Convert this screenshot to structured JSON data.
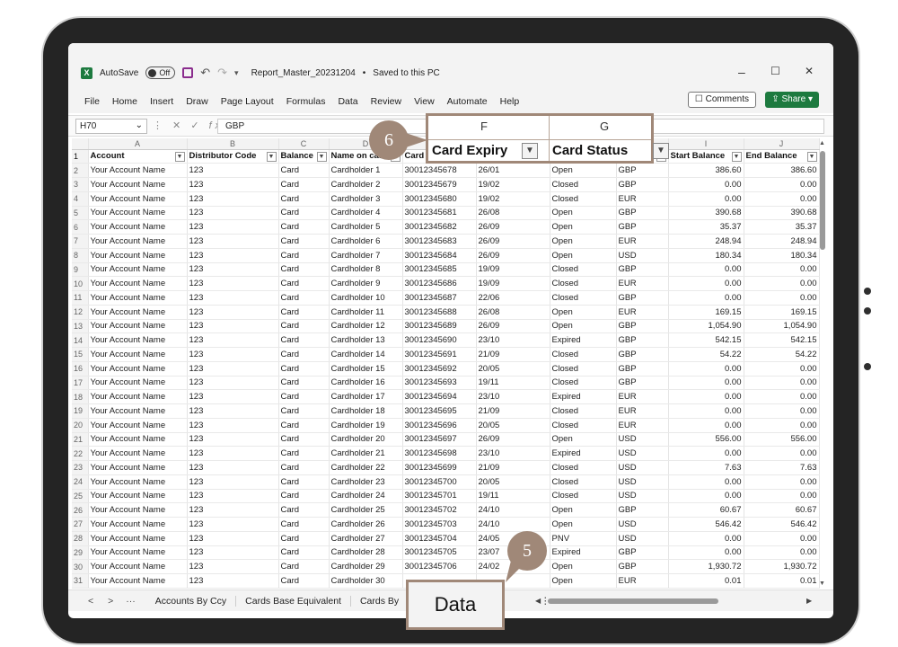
{
  "titlebar": {
    "autosave_label": "AutoSave",
    "autosave_state": "Off",
    "filename": "Report_Master_20231204",
    "saved_status": "Saved to this PC",
    "minimize": "–",
    "maximize": "☐",
    "close": "✕"
  },
  "menu": [
    "File",
    "Home",
    "Insert",
    "Draw",
    "Page Layout",
    "Formulas",
    "Data",
    "Review",
    "View",
    "Automate",
    "Help"
  ],
  "comments_label": "Comments",
  "share_label": "Share",
  "formula": {
    "cell_ref": "H70",
    "fx": "fx",
    "value": "GBP"
  },
  "columns": [
    "",
    "A",
    "B",
    "C",
    "D",
    "E",
    "F",
    "G",
    "H",
    "I",
    "J"
  ],
  "headers": [
    "Account",
    "Distributor Code",
    "Balance",
    "Name on card",
    "Card",
    "",
    "",
    "",
    "Start Balance",
    "End Balance"
  ],
  "rows": [
    [
      "Your Account Name",
      "123",
      "Card",
      "Cardholder 1",
      "30012345678",
      "26/01",
      "Open",
      "GBP",
      "386.60",
      "386.60"
    ],
    [
      "Your Account Name",
      "123",
      "Card",
      "Cardholder 2",
      "30012345679",
      "19/02",
      "Closed",
      "GBP",
      "0.00",
      "0.00"
    ],
    [
      "Your Account Name",
      "123",
      "Card",
      "Cardholder 3",
      "30012345680",
      "19/02",
      "Closed",
      "EUR",
      "0.00",
      "0.00"
    ],
    [
      "Your Account Name",
      "123",
      "Card",
      "Cardholder 4",
      "30012345681",
      "26/08",
      "Open",
      "GBP",
      "390.68",
      "390.68"
    ],
    [
      "Your Account Name",
      "123",
      "Card",
      "Cardholder 5",
      "30012345682",
      "26/09",
      "Open",
      "GBP",
      "35.37",
      "35.37"
    ],
    [
      "Your Account Name",
      "123",
      "Card",
      "Cardholder 6",
      "30012345683",
      "26/09",
      "Open",
      "EUR",
      "248.94",
      "248.94"
    ],
    [
      "Your Account Name",
      "123",
      "Card",
      "Cardholder 7",
      "30012345684",
      "26/09",
      "Open",
      "USD",
      "180.34",
      "180.34"
    ],
    [
      "Your Account Name",
      "123",
      "Card",
      "Cardholder 8",
      "30012345685",
      "19/09",
      "Closed",
      "GBP",
      "0.00",
      "0.00"
    ],
    [
      "Your Account Name",
      "123",
      "Card",
      "Cardholder 9",
      "30012345686",
      "19/09",
      "Closed",
      "EUR",
      "0.00",
      "0.00"
    ],
    [
      "Your Account Name",
      "123",
      "Card",
      "Cardholder 10",
      "30012345687",
      "22/06",
      "Closed",
      "GBP",
      "0.00",
      "0.00"
    ],
    [
      "Your Account Name",
      "123",
      "Card",
      "Cardholder 11",
      "30012345688",
      "26/08",
      "Open",
      "EUR",
      "169.15",
      "169.15"
    ],
    [
      "Your Account Name",
      "123",
      "Card",
      "Cardholder 12",
      "30012345689",
      "26/09",
      "Open",
      "GBP",
      "1,054.90",
      "1,054.90"
    ],
    [
      "Your Account Name",
      "123",
      "Card",
      "Cardholder 13",
      "30012345690",
      "23/10",
      "Expired",
      "GBP",
      "542.15",
      "542.15"
    ],
    [
      "Your Account Name",
      "123",
      "Card",
      "Cardholder 14",
      "30012345691",
      "21/09",
      "Closed",
      "GBP",
      "54.22",
      "54.22"
    ],
    [
      "Your Account Name",
      "123",
      "Card",
      "Cardholder 15",
      "30012345692",
      "20/05",
      "Closed",
      "GBP",
      "0.00",
      "0.00"
    ],
    [
      "Your Account Name",
      "123",
      "Card",
      "Cardholder 16",
      "30012345693",
      "19/11",
      "Closed",
      "GBP",
      "0.00",
      "0.00"
    ],
    [
      "Your Account Name",
      "123",
      "Card",
      "Cardholder 17",
      "30012345694",
      "23/10",
      "Expired",
      "EUR",
      "0.00",
      "0.00"
    ],
    [
      "Your Account Name",
      "123",
      "Card",
      "Cardholder 18",
      "30012345695",
      "21/09",
      "Closed",
      "EUR",
      "0.00",
      "0.00"
    ],
    [
      "Your Account Name",
      "123",
      "Card",
      "Cardholder 19",
      "30012345696",
      "20/05",
      "Closed",
      "EUR",
      "0.00",
      "0.00"
    ],
    [
      "Your Account Name",
      "123",
      "Card",
      "Cardholder 20",
      "30012345697",
      "26/09",
      "Open",
      "USD",
      "556.00",
      "556.00"
    ],
    [
      "Your Account Name",
      "123",
      "Card",
      "Cardholder 21",
      "30012345698",
      "23/10",
      "Expired",
      "USD",
      "0.00",
      "0.00"
    ],
    [
      "Your Account Name",
      "123",
      "Card",
      "Cardholder 22",
      "30012345699",
      "21/09",
      "Closed",
      "USD",
      "7.63",
      "7.63"
    ],
    [
      "Your Account Name",
      "123",
      "Card",
      "Cardholder 23",
      "30012345700",
      "20/05",
      "Closed",
      "USD",
      "0.00",
      "0.00"
    ],
    [
      "Your Account Name",
      "123",
      "Card",
      "Cardholder 24",
      "30012345701",
      "19/11",
      "Closed",
      "USD",
      "0.00",
      "0.00"
    ],
    [
      "Your Account Name",
      "123",
      "Card",
      "Cardholder 25",
      "30012345702",
      "24/10",
      "Open",
      "GBP",
      "60.67",
      "60.67"
    ],
    [
      "Your Account Name",
      "123",
      "Card",
      "Cardholder 26",
      "30012345703",
      "24/10",
      "Open",
      "USD",
      "546.42",
      "546.42"
    ],
    [
      "Your Account Name",
      "123",
      "Card",
      "Cardholder 27",
      "30012345704",
      "24/05",
      "PNV",
      "USD",
      "0.00",
      "0.00"
    ],
    [
      "Your Account Name",
      "123",
      "Card",
      "Cardholder 28",
      "30012345705",
      "23/07",
      "Expired",
      "GBP",
      "0.00",
      "0.00"
    ],
    [
      "Your Account Name",
      "123",
      "Card",
      "Cardholder 29",
      "30012345706",
      "24/02",
      "Open",
      "GBP",
      "1,930.72",
      "1,930.72"
    ],
    [
      "Your Account Name",
      "123",
      "Card",
      "Cardholder 30",
      "",
      "",
      "Open",
      "EUR",
      "0.01",
      "0.01"
    ]
  ],
  "sheet_tabs": [
    "Accounts By Ccy",
    "Cards Base Equivalent",
    "Cards By"
  ],
  "callout": {
    "col_f": "F",
    "col_g": "G",
    "card_expiry": "Card Expiry",
    "card_status": "Card Status",
    "badge_6": "6",
    "badge_5": "5",
    "data_label": "Data"
  },
  "colors": {
    "excel_green": "#1d7a3f",
    "callout_brown": "#a08878",
    "device": "#242424"
  }
}
